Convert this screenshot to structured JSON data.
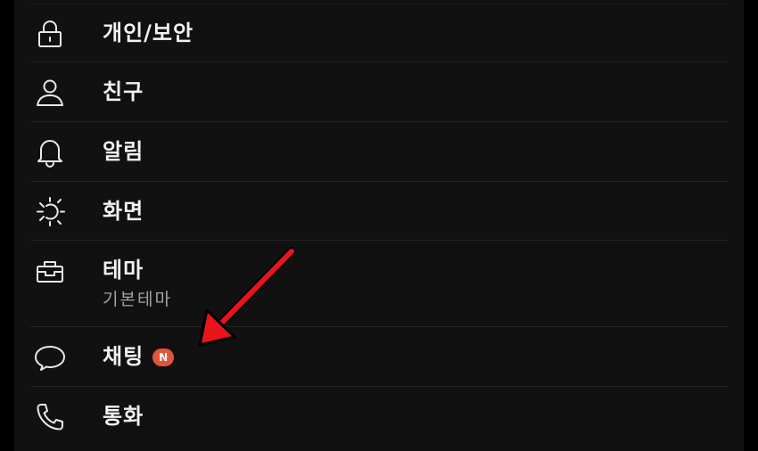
{
  "colors": {
    "background": "#111111",
    "text": "#f2f2f2",
    "subtext": "#a3a3a3",
    "divider": "#232323",
    "badge": "#e2553a",
    "annotation_arrow": "#e8151b"
  },
  "settings": {
    "items": [
      {
        "label": "개인/보안",
        "icon": "lock-icon"
      },
      {
        "label": "친구",
        "icon": "person-icon"
      },
      {
        "label": "알림",
        "icon": "bell-icon"
      },
      {
        "label": "화면",
        "icon": "display-brightness-icon"
      },
      {
        "label": "테마",
        "sublabel": "기본테마",
        "icon": "theme-bag-icon"
      },
      {
        "label": "채팅",
        "badge": "N",
        "icon": "speech-bubble-icon"
      },
      {
        "label": "통화",
        "icon": "phone-icon"
      }
    ]
  }
}
